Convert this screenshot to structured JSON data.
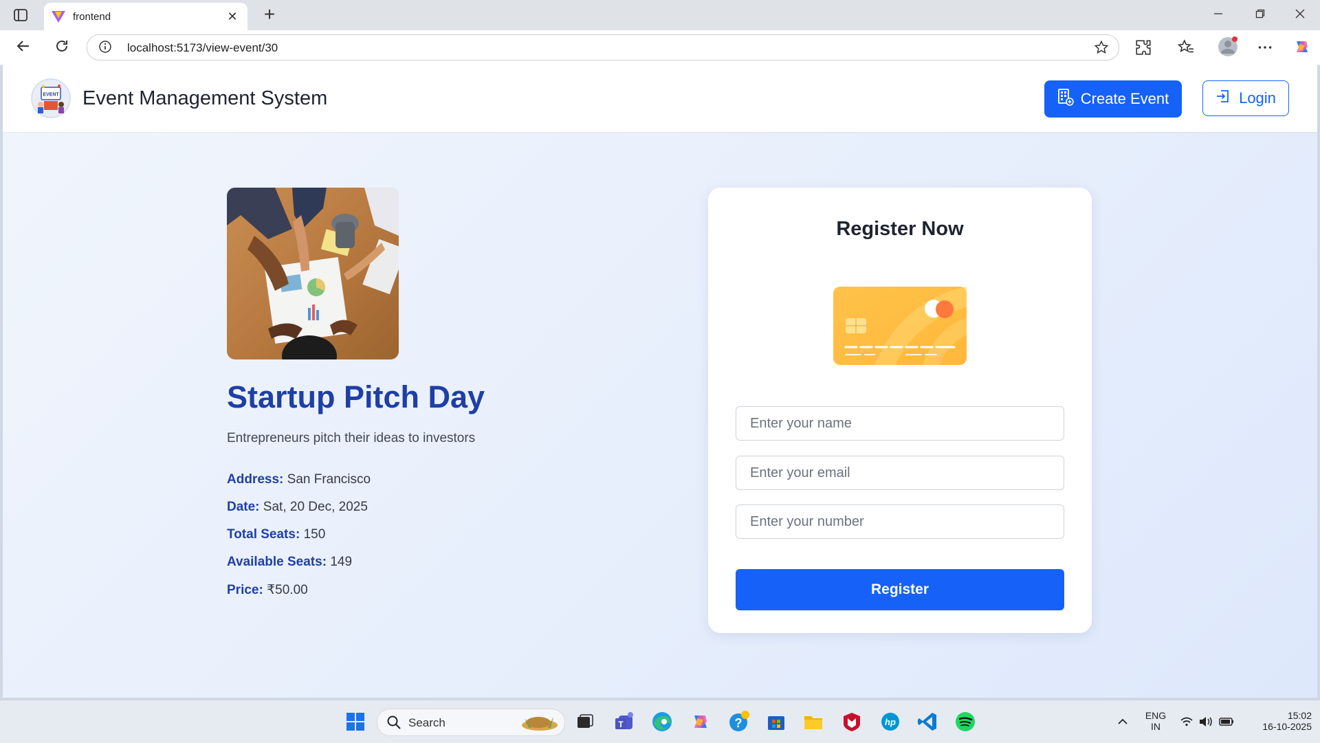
{
  "browser": {
    "tab_title": "frontend",
    "url": "localhost:5173/view-event/30",
    "new_tab_symbol": "+",
    "close_symbol": "✕"
  },
  "app": {
    "brand": "Event Management System",
    "logo_text": "EVENT",
    "create_event_label": "Create Event",
    "login_label": "Login"
  },
  "event": {
    "title": "Startup Pitch Day",
    "description": "Entrepreneurs pitch their ideas to investors",
    "details": [
      {
        "label": "Address:",
        "value": "San Francisco"
      },
      {
        "label": "Date:",
        "value": "Sat, 20 Dec, 2025"
      },
      {
        "label": "Total Seats:",
        "value": "150"
      },
      {
        "label": "Available Seats:",
        "value": "149"
      },
      {
        "label": "Price:",
        "value": "₹50.00"
      }
    ]
  },
  "register_form": {
    "heading": "Register Now",
    "name_placeholder": "Enter your name",
    "email_placeholder": "Enter your email",
    "number_placeholder": "Enter your number",
    "submit_label": "Register"
  },
  "taskbar": {
    "search_label": "Search",
    "lang_line1": "ENG",
    "lang_line2": "IN",
    "time": "15:02",
    "date": "16-10-2025"
  },
  "colors": {
    "primary": "#1662f8",
    "title_blue": "#1e3fa6"
  }
}
